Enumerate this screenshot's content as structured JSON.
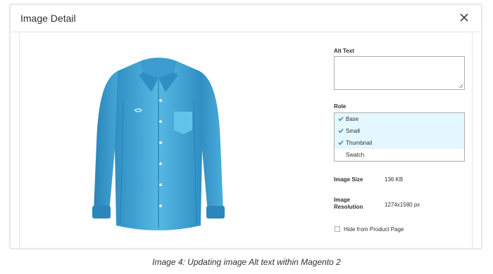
{
  "dialog": {
    "title": "Image Detail",
    "close_icon": "close-icon"
  },
  "image": {
    "icon": "shirt-image",
    "description_color": "#4aa9d8"
  },
  "form": {
    "alt_text": {
      "label": "Alt Text",
      "value": ""
    },
    "role": {
      "label": "Role",
      "options": [
        {
          "label": "Base",
          "selected": true
        },
        {
          "label": "Small",
          "selected": true
        },
        {
          "label": "Thumbnail",
          "selected": true
        },
        {
          "label": "Swatch",
          "selected": false
        }
      ]
    },
    "image_size": {
      "label": "Image Size",
      "value": "136 KB"
    },
    "image_resolution": {
      "label": "Image Resolution",
      "value": "1274x1580 px"
    },
    "hide_from_product_page": {
      "label": "Hide from Product Page",
      "checked": false
    }
  },
  "caption": "Image 4: Updating image Alt text within Magento 2",
  "colors": {
    "selected_bg": "#e5f7fe",
    "check": "#1979c3"
  }
}
